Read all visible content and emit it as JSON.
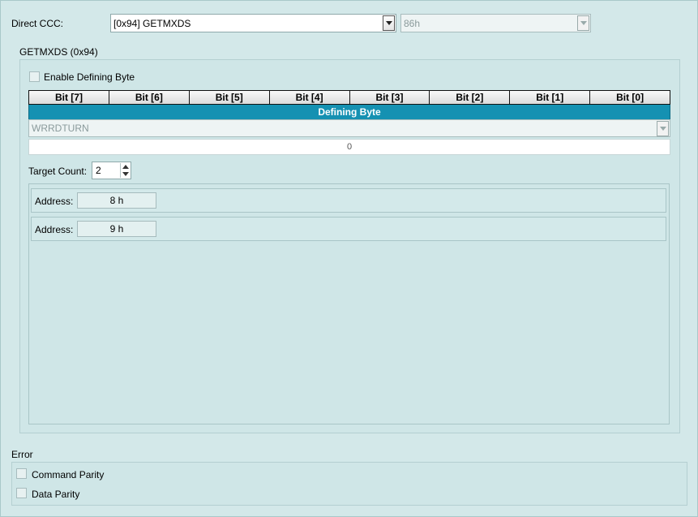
{
  "direct_ccc": {
    "label": "Direct CCC:",
    "selected": "[0x94] GETMXDS",
    "secondary_value": "86h"
  },
  "getmxds_group": {
    "title": "GETMXDS (0x94)",
    "enable_defining_byte_label": "Enable Defining Byte",
    "enable_defining_byte_checked": false,
    "bits": [
      "Bit [7]",
      "Bit [6]",
      "Bit [5]",
      "Bit [4]",
      "Bit [3]",
      "Bit [2]",
      "Bit [1]",
      "Bit [0]"
    ],
    "defining_byte_label": "Defining Byte",
    "defining_byte_combo_value": "WRRDTURN",
    "defining_byte_value": "0",
    "target_count_label": "Target Count:",
    "target_count_value": "2",
    "targets": [
      {
        "label": "Address:",
        "value": "8 h"
      },
      {
        "label": "Address:",
        "value": "9 h"
      }
    ]
  },
  "error_group": {
    "title": "Error",
    "options": [
      {
        "label": "Command Parity",
        "checked": false
      },
      {
        "label": "Data Parity",
        "checked": false
      }
    ]
  },
  "colors": {
    "background": "#d3e8e9",
    "defining_byte_bar": "#1591b2"
  }
}
